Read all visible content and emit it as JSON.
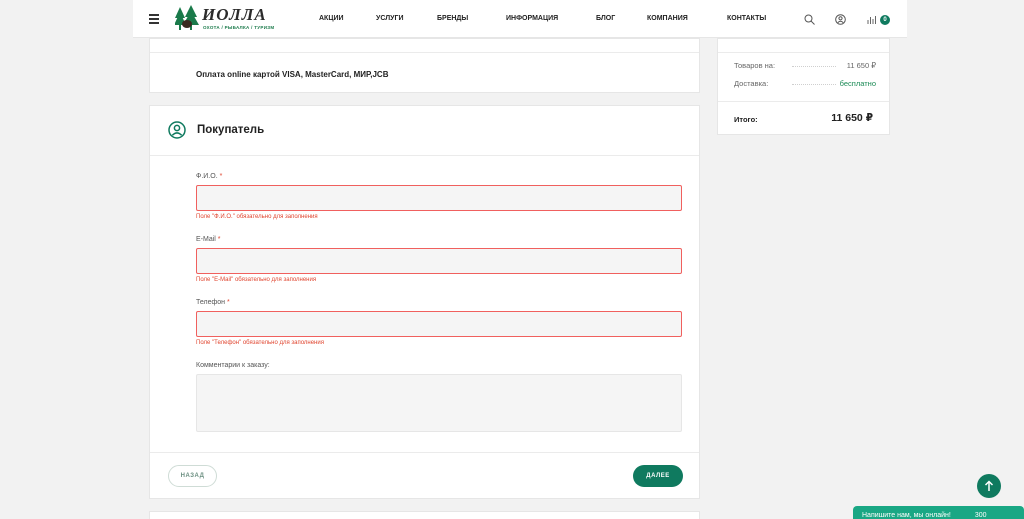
{
  "header": {
    "logo": {
      "text": "ИОЛЛА",
      "subtitle": "ОХОТА / РЫБАЛКА / ТУРИЗМ"
    },
    "nav": [
      "АКЦИИ",
      "УСЛУГИ",
      "БРЕНДЫ",
      "ИНФОРМАЦИЯ",
      "БЛОГ",
      "КОМПАНИЯ",
      "КОНТАКТЫ"
    ],
    "cart_count": "0"
  },
  "payment": {
    "method": "Оплата online картой VISA, MasterCard, МИР,JCB"
  },
  "buyer": {
    "title": "Покупатель",
    "fields": [
      {
        "label": "Ф.И.О.",
        "required": "*",
        "value": "",
        "error": "Поле \"Ф.И.О.\" обязательно для заполнения"
      },
      {
        "label": "E-Mail",
        "required": "*",
        "value": "",
        "error": "Поле \"E-Mail\" обязательно для заполнения"
      },
      {
        "label": "Телефон",
        "required": "*",
        "value": "",
        "error": "Поле \"Телефон\" обязательно для заполнения"
      }
    ],
    "comment_label": "Комментарии к заказу:",
    "comment_value": "",
    "back_label": "НАЗАД",
    "next_label": "ДАЛЕЕ"
  },
  "summary": {
    "goods_label": "Товаров на:",
    "goods_value": "11 650 ₽",
    "delivery_label": "Доставка:",
    "delivery_value": "бесплатно",
    "total_label": "Итого:",
    "total_value": "11 650 ₽"
  },
  "chat": {
    "text": "Напишите нам, мы онлайн!",
    "extra": "300"
  },
  "colors": {
    "accent": "#0f7a5f",
    "error": "#e0452f",
    "chat": "#1aa784"
  },
  "icons": [
    "menu-icon",
    "logo-trees-icon",
    "search-icon",
    "user-icon",
    "cart-icon",
    "user-circle-icon",
    "arrow-up-icon"
  ]
}
